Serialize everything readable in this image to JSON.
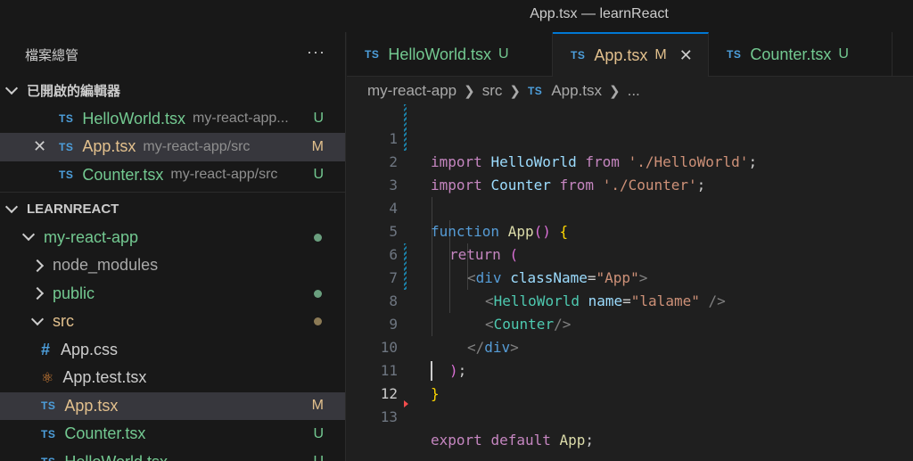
{
  "window": {
    "title": "App.tsx — learnReact"
  },
  "explorer": {
    "header": "檔案總管",
    "more": "···",
    "open_editors_section": "已開啟的編輯器",
    "open_editors": [
      {
        "icon": "TS",
        "name": "HelloWorld.tsx",
        "path": "my-react-app...",
        "status": "U"
      },
      {
        "icon": "TS",
        "name": "App.tsx",
        "path": "my-react-app/src",
        "status": "M",
        "close": "✕"
      },
      {
        "icon": "TS",
        "name": "Counter.tsx",
        "path": "my-react-app/src",
        "status": "U"
      }
    ],
    "project_section": "LEARNREACT",
    "tree": [
      {
        "name": "my-react-app"
      },
      {
        "name": "node_modules"
      },
      {
        "name": "public"
      },
      {
        "name": "src"
      },
      {
        "icon": "#",
        "name": "App.css"
      },
      {
        "icon": "react",
        "name": "App.test.tsx"
      },
      {
        "icon": "TS",
        "name": "App.tsx",
        "status": "M"
      },
      {
        "icon": "TS",
        "name": "Counter.tsx",
        "status": "U"
      },
      {
        "icon": "TS",
        "name": "HelloWorld.tsx",
        "status": "U"
      }
    ]
  },
  "tabs": [
    {
      "icon": "TS",
      "label": "HelloWorld.tsx",
      "status": "U"
    },
    {
      "icon": "TS",
      "label": "App.tsx",
      "status": "M",
      "close": "✕"
    },
    {
      "icon": "TS",
      "label": "Counter.tsx",
      "status": "U"
    }
  ],
  "breadcrumb": {
    "root": "my-react-app",
    "folder": "src",
    "icon": "TS",
    "file": "App.tsx",
    "more": "..."
  },
  "editor": {
    "line_numbers": [
      "1",
      "2",
      "3",
      "4",
      "5",
      "6",
      "7",
      "8",
      "9",
      "10",
      "11",
      "12",
      "13"
    ],
    "tokens": {
      "l1": [
        "import",
        "HelloWorld",
        "from",
        "'./HelloWorld'",
        ";"
      ],
      "l2": [
        "import",
        "Counter",
        "from",
        "'./Counter'",
        ";"
      ],
      "l4": [
        "function",
        "App",
        "()",
        "{"
      ],
      "l5": [
        "return",
        "("
      ],
      "l6": [
        "<",
        "div",
        "className",
        "=",
        "\"App\"",
        ">"
      ],
      "l7": [
        "<",
        "HelloWorld",
        "name",
        "=",
        "\"lalame\"",
        "/>"
      ],
      "l8": [
        "<",
        "Counter",
        "/>"
      ],
      "l9": [
        "</",
        "div",
        ">"
      ],
      "l10": [
        ")",
        ";"
      ],
      "l11": [
        "}"
      ],
      "l13": [
        "export",
        "default",
        "App",
        ";"
      ]
    }
  },
  "colors": {
    "accent": "#0078d4",
    "untracked": "#73c991",
    "modified": "#e2c08d",
    "ts_icon": "#4d9fdc"
  }
}
